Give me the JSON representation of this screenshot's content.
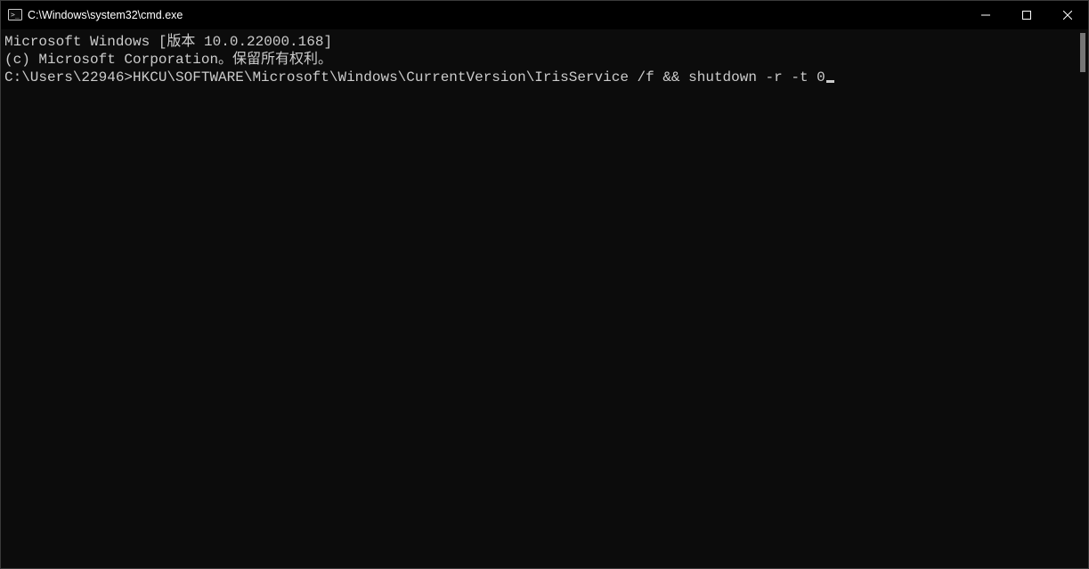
{
  "window": {
    "title": "C:\\Windows\\system32\\cmd.exe"
  },
  "terminal": {
    "line1": "Microsoft Windows [版本 10.0.22000.168]",
    "line2": "(c) Microsoft Corporation。保留所有权利。",
    "blank": "",
    "prompt": "C:\\Users\\22946>",
    "command": "HKCU\\SOFTWARE\\Microsoft\\Windows\\CurrentVersion\\IrisService /f && shutdown -r -t 0"
  }
}
